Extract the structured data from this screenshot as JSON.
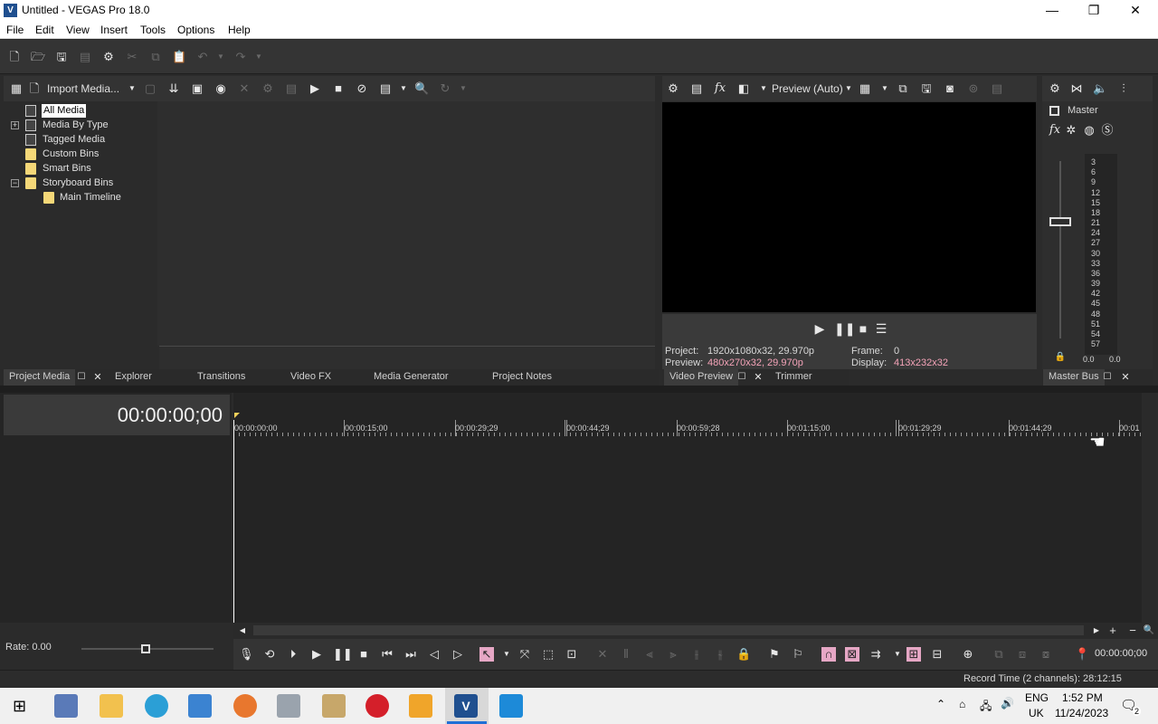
{
  "window": {
    "title": "Untitled - VEGAS Pro 18.0",
    "app_icon_letter": "V",
    "minimize": "—",
    "maximize": "❐",
    "close": "✕"
  },
  "menu": [
    "File",
    "Edit",
    "View",
    "Insert",
    "Tools",
    "Options",
    "Help"
  ],
  "project_media": {
    "import_label": "Import Media...",
    "tree": [
      {
        "label": "All Media",
        "selected": true
      },
      {
        "label": "Media By Type",
        "expander": "+"
      },
      {
        "label": "Tagged Media"
      },
      {
        "label": "Custom Bins"
      },
      {
        "label": "Smart Bins"
      },
      {
        "label": "Storyboard Bins",
        "expander": "−"
      },
      {
        "label": "Main Timeline"
      }
    ]
  },
  "left_tabs": {
    "project_media": "Project Media",
    "explorer": "Explorer",
    "transitions": "Transitions",
    "video_fx": "Video FX",
    "media_generator": "Media Generator",
    "project_notes": "Project Notes"
  },
  "video_preview": {
    "mode": "Preview (Auto)",
    "project_label": "Project:",
    "project_value": "1920x1080x32, 29.970p",
    "preview_label": "Preview:",
    "preview_value": "480x270x32, 29.970p",
    "frame_label": "Frame:",
    "frame_value": "0",
    "display_label": "Display:",
    "display_value": "413x232x32",
    "tab_video_preview": "Video Preview",
    "tab_trimmer": "Trimmer"
  },
  "master_bus": {
    "master_label": "Master",
    "meter_labels": [
      "3",
      "6",
      "9",
      "12",
      "15",
      "18",
      "21",
      "24",
      "27",
      "30",
      "33",
      "36",
      "39",
      "42",
      "45",
      "48",
      "51",
      "54",
      "57"
    ],
    "left_value": "0.0",
    "right_value": "0.0",
    "tab_label": "Master Bus"
  },
  "timeline": {
    "timecode": "00:00:00;00",
    "ruler": [
      "00:00:00;00",
      "00:00:15;00",
      "00:00:29;29",
      "00:00:44;29",
      "00:00:59;28",
      "00:01:15;00",
      "00:01:29;29",
      "00:01:44;29",
      "00:01"
    ],
    "rate_label": "Rate: 0.00",
    "end_timecode": "00:00:00;00"
  },
  "status": {
    "record_time": "Record Time (2 channels): 28:12:15"
  },
  "taskbar": {
    "lang_top": "ENG",
    "lang_bottom": "UK",
    "time": "1:52 PM",
    "date": "11/24/2023",
    "notif_count": "2"
  },
  "colors": {
    "accent_pink": "#f4a3b8",
    "folder_yellow": "#f5d878",
    "toggle_pink": "#e6a7c5"
  }
}
